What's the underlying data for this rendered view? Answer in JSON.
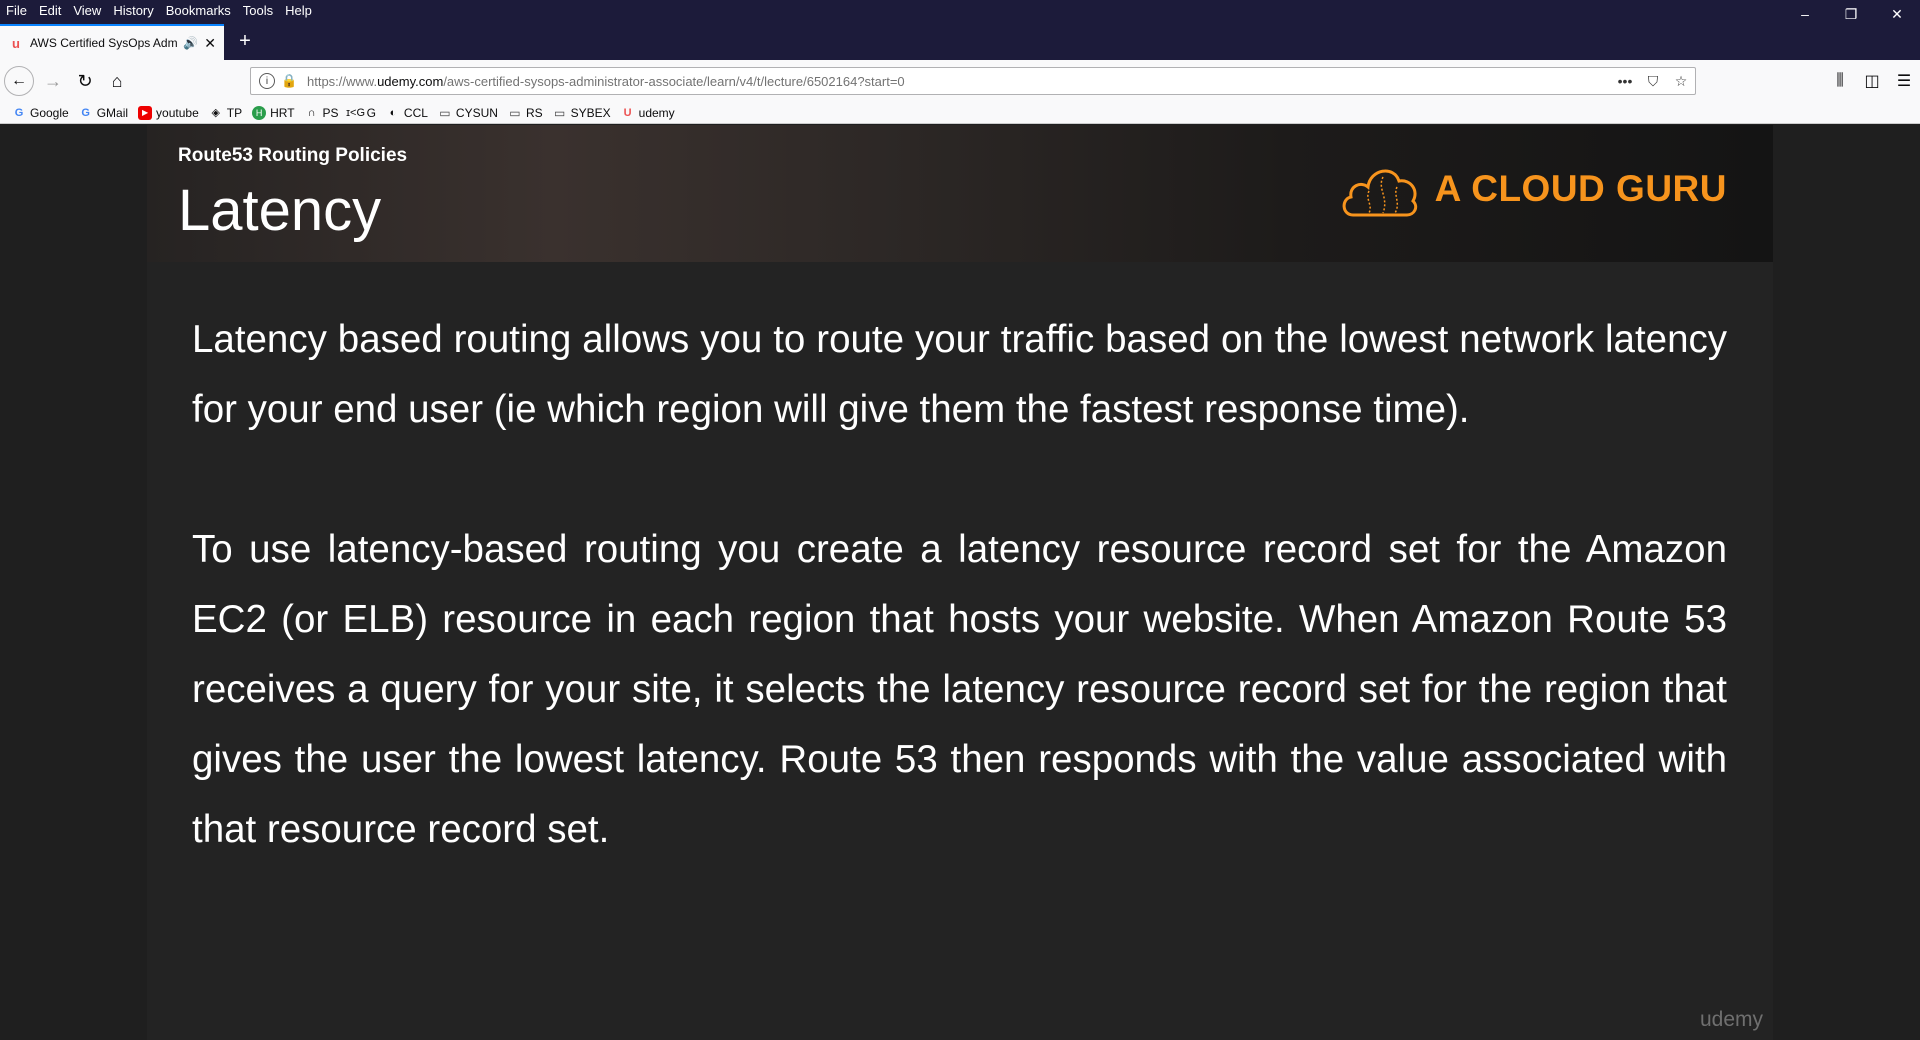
{
  "menu": [
    "File",
    "Edit",
    "View",
    "History",
    "Bookmarks",
    "Tools",
    "Help"
  ],
  "window_controls": {
    "minimize": "–",
    "restore": "❐",
    "close": "✕"
  },
  "tab": {
    "title": "AWS Certified SysOps Admi",
    "favicon": "udemy-icon",
    "sound": "speaker-icon"
  },
  "newtab_label": "+",
  "url": {
    "host": "https://www.",
    "domain": "udemy.com",
    "path": "/aws-certified-sysops-administrator-associate/learn/v4/t/lecture/6502164?start=0"
  },
  "bookmarks": [
    {
      "label": "Google",
      "icon": "G"
    },
    {
      "label": "GMail",
      "icon": "G"
    },
    {
      "label": "youtube",
      "icon": "▶"
    },
    {
      "label": "TP",
      "icon": "◈"
    },
    {
      "label": "HRT",
      "icon": "H"
    },
    {
      "label": "PS",
      "icon": "∩"
    },
    {
      "label": "G",
      "icon": "ɪ<G"
    },
    {
      "label": "CCL",
      "icon": "◐"
    },
    {
      "label": "CYSUN",
      "icon": "▭"
    },
    {
      "label": "RS",
      "icon": "▭"
    },
    {
      "label": "SYBEX",
      "icon": "▭"
    },
    {
      "label": "udemy",
      "icon": "U"
    }
  ],
  "slide": {
    "subtitle": "Route53 Routing Policies",
    "title": "Latency",
    "brand": "A CLOUD GURU",
    "paragraphs": [
      "Latency based routing allows you to route your traffic based on the lowest network latency for your end user (ie which region will give them the fastest response time).",
      "To use latency-based routing you create a latency resource record set for the Amazon EC2 (or ELB) resource in each region that hosts your website. When Amazon Route 53 receives a query for your site, it selects the latency resource record set for the region that gives the user the lowest latency. Route 53 then responds with the value associated with that resource record set."
    ],
    "watermark": "udemy"
  },
  "colors": {
    "accent": "#f7941d",
    "tab_border": "#0a84ff",
    "chrome_dark": "#1c1b3a"
  }
}
